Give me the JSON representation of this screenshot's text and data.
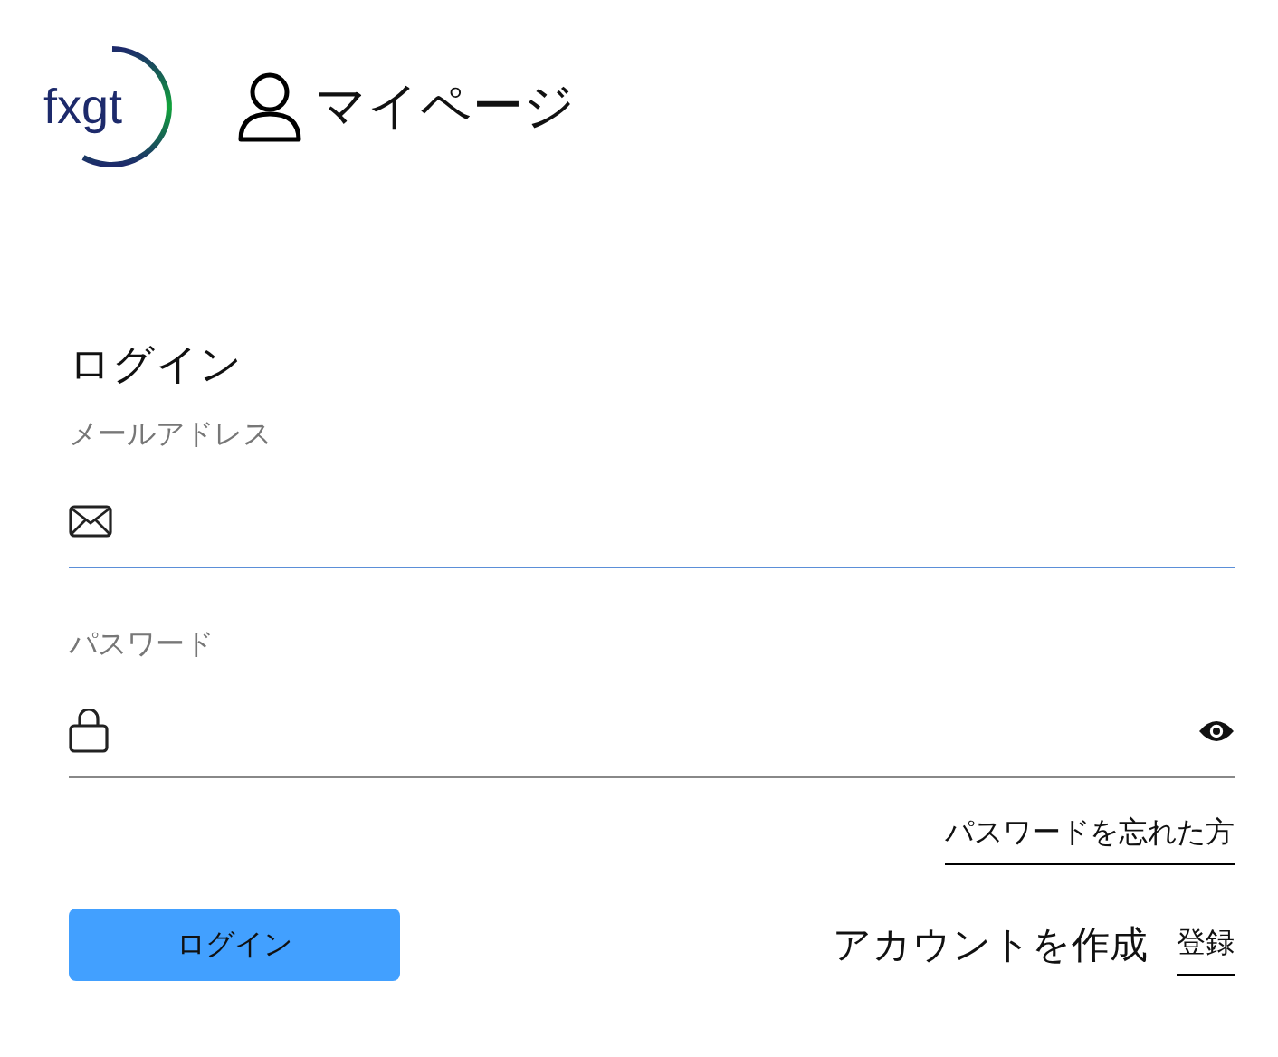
{
  "header": {
    "logo": "fxgt",
    "title": "マイページ"
  },
  "login": {
    "heading": "ログイン",
    "fields": [
      {
        "kind": "email",
        "label": "メールアドレス",
        "focused": true
      },
      {
        "kind": "password",
        "label": "パスワード",
        "focused": false
      }
    ],
    "forgot_link": "パスワードを忘れた方",
    "submit": "ログイン",
    "create_account": "アカウントを作成",
    "register_link": "登録"
  }
}
